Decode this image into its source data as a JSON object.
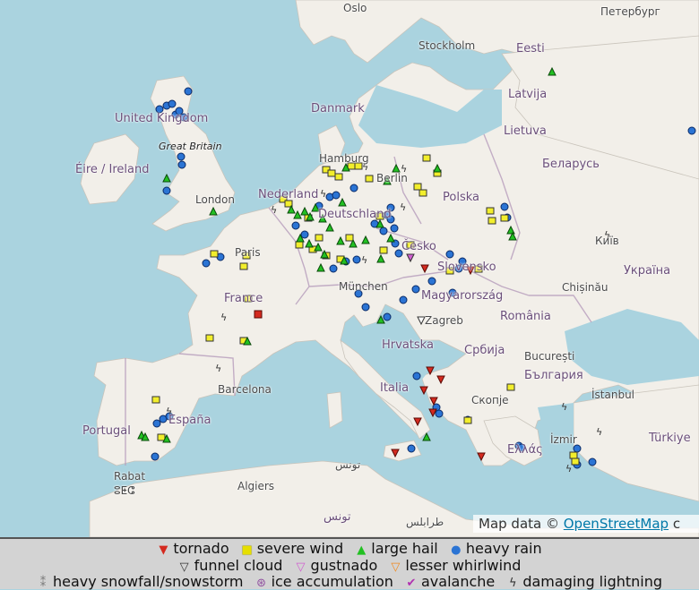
{
  "places": [
    {
      "id": "oslo",
      "label": "Oslo"
    },
    {
      "id": "stockholm",
      "label": "Stockholm"
    },
    {
      "id": "peterburg",
      "label": "Петербург"
    },
    {
      "id": "eesti",
      "label": "Eesti"
    },
    {
      "id": "latvija",
      "label": "Latvija"
    },
    {
      "id": "lietuva",
      "label": "Lietuva"
    },
    {
      "id": "danmark",
      "label": "Danmark"
    },
    {
      "id": "uk",
      "label": "United Kingdom"
    },
    {
      "id": "gb",
      "label": "Great Britain"
    },
    {
      "id": "eire",
      "label": "Éire / Ireland"
    },
    {
      "id": "london",
      "label": "London"
    },
    {
      "id": "hamburg",
      "label": "Hamburg"
    },
    {
      "id": "berlin",
      "label": "Berlin"
    },
    {
      "id": "nederland",
      "label": "Nederland"
    },
    {
      "id": "deutschland",
      "label": "Deutschland"
    },
    {
      "id": "polska",
      "label": "Polska"
    },
    {
      "id": "belarus",
      "label": "Беларусь"
    },
    {
      "id": "kyiv",
      "label": "Київ"
    },
    {
      "id": "ukraina",
      "label": "Україна"
    },
    {
      "id": "paris",
      "label": "Paris"
    },
    {
      "id": "france",
      "label": "France"
    },
    {
      "id": "cesko",
      "label": "Česko"
    },
    {
      "id": "slovensko",
      "label": "Slovensko"
    },
    {
      "id": "munchen",
      "label": "München"
    },
    {
      "id": "magyar",
      "label": "Magyarország"
    },
    {
      "id": "chisinau",
      "label": "Chișinău"
    },
    {
      "id": "romania",
      "label": "România"
    },
    {
      "id": "zagreb",
      "label": "Zagreb"
    },
    {
      "id": "hrvatska",
      "label": "Hrvatska"
    },
    {
      "id": "srbija",
      "label": "Србија"
    },
    {
      "id": "bucuresti",
      "label": "București"
    },
    {
      "id": "balgaria",
      "label": "България"
    },
    {
      "id": "italia",
      "label": "Italia"
    },
    {
      "id": "skopje",
      "label": "Скопје"
    },
    {
      "id": "istanbul",
      "label": "İstanbul"
    },
    {
      "id": "barcelona",
      "label": "Barcelona"
    },
    {
      "id": "espana",
      "label": "España"
    },
    {
      "id": "portugal",
      "label": "Portugal"
    },
    {
      "id": "izmir",
      "label": "İzmir"
    },
    {
      "id": "turkiye",
      "label": "Türkiye"
    },
    {
      "id": "ellas",
      "label": "Ελλάς"
    },
    {
      "id": "tunis",
      "label": "تونس"
    },
    {
      "id": "tunis2",
      "label": "تونس"
    },
    {
      "id": "rabat",
      "label": "Rabat"
    },
    {
      "id": "rabat2",
      "label": "ⵓⵟⵛ"
    },
    {
      "id": "algiers",
      "label": "Algiers"
    },
    {
      "id": "tarabulus",
      "label": "طرابلس"
    }
  ],
  "attribution": {
    "prefix": "Map data © ",
    "link": "OpenStreetMap",
    "suffix": " c"
  },
  "legend": {
    "row1": [
      {
        "key": "tornado",
        "label": "tornado",
        "color": "#d42a1f",
        "symbol": "▼"
      },
      {
        "key": "severe_wind",
        "label": "severe wind",
        "color": "#f2ee2c",
        "symbol": "■"
      },
      {
        "key": "large_hail",
        "label": "large hail",
        "color": "#22c022",
        "symbol": "▲"
      },
      {
        "key": "heavy_rain",
        "label": "heavy rain",
        "color": "#2b74d4",
        "symbol": "●"
      }
    ],
    "row2": [
      {
        "key": "funnel_cloud",
        "label": "funnel cloud",
        "color": "#ffffff",
        "symbol": "▽"
      },
      {
        "key": "gustnado",
        "label": "gustnado",
        "color": "#d060d0",
        "symbol": "▽"
      },
      {
        "key": "lesser_whirlwind",
        "label": "lesser whirlwind",
        "color": "#f08a20",
        "symbol": "▽"
      }
    ],
    "row3": [
      {
        "key": "heavy_snowfall",
        "label": "heavy snowfall/snowstorm",
        "color": "#777777",
        "symbol": "⁑"
      },
      {
        "key": "ice_accumulation",
        "label": "ice accumulation",
        "color": "#9050a0",
        "symbol": "⊛"
      },
      {
        "key": "avalanche",
        "label": "avalanche",
        "color": "#b030b0",
        "symbol": "✔"
      },
      {
        "key": "damaging_lightning",
        "label": "damaging lightning",
        "color": "#333333",
        "symbol": "ϟ"
      }
    ]
  },
  "colors": {
    "sea": "#aad3df",
    "land": "#f2efe9",
    "border": "#a58aa8",
    "tornado": "#d42a1f",
    "severe_wind": "#f2ee2c",
    "large_hail": "#22c022",
    "heavy_rain": "#2b74d4",
    "lightning": "#333333"
  }
}
